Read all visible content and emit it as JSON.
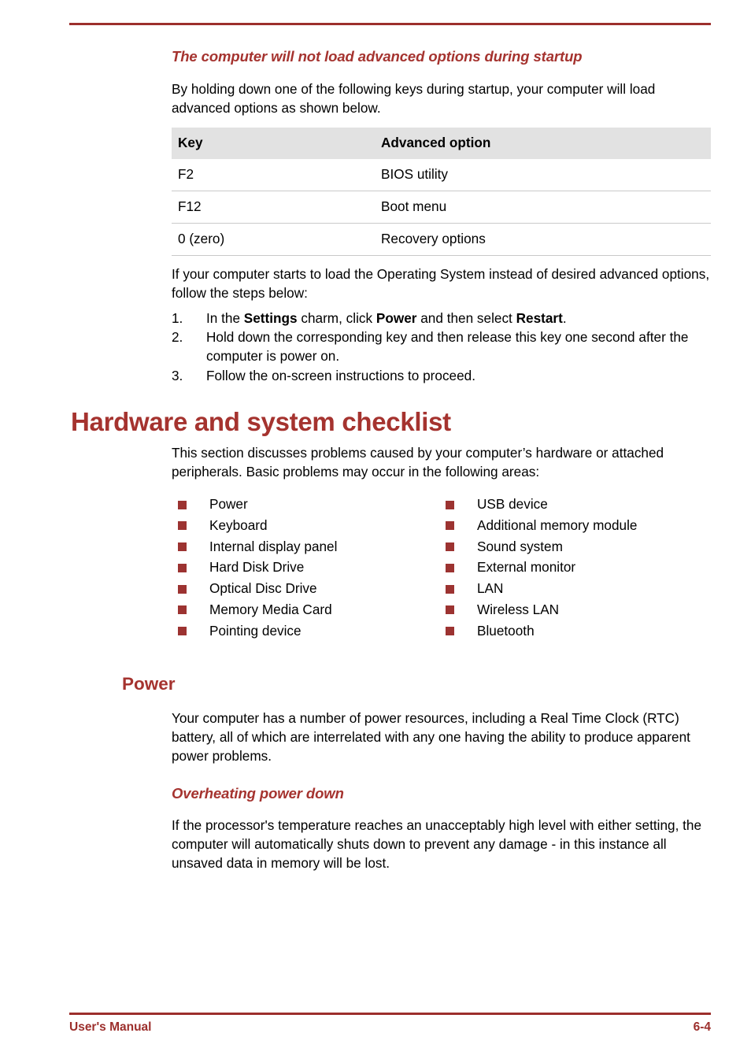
{
  "page": {
    "rule_color": "#9c2f2c",
    "heading_color": "#a5332f",
    "bullet_color": "#9c3331",
    "table_header_bg": "#e2e2e2"
  },
  "section_heading_1": "The computer will not load advanced options during startup",
  "intro_paragraph": "By holding down one of the following keys during startup, your computer will load advanced options as shown below.",
  "table": {
    "headers": [
      "Key",
      "Advanced option"
    ],
    "rows": [
      {
        "key": "F2",
        "option": "BIOS utility"
      },
      {
        "key": "F12",
        "option": "Boot menu"
      },
      {
        "key": "0 (zero)",
        "option": "Recovery options"
      }
    ]
  },
  "after_table_paragraph": "If your computer starts to load the Operating System instead of desired advanced options, follow the steps below:",
  "steps": [
    {
      "num": "1.",
      "html": "In the <b>Settings</b> charm, click <b>Power</b> and then select <b>Restart</b>."
    },
    {
      "num": "2.",
      "html": "Hold down the corresponding key and then release this key one second after the computer is power on."
    },
    {
      "num": "3.",
      "html": "Follow the on-screen instructions to proceed."
    }
  ],
  "chapter_heading": "Hardware and system checklist",
  "chapter_paragraph": "This section discusses problems caused by your computer’s hardware or attached peripherals. Basic problems may occur in the following areas:",
  "checklist": {
    "left_column": [
      "Power",
      "Keyboard",
      "Internal display panel",
      "Hard Disk Drive",
      "Optical Disc Drive",
      "Memory Media Card",
      "Pointing device"
    ],
    "right_column": [
      "USB device",
      "Additional memory module",
      "Sound system",
      "External monitor",
      "LAN",
      "Wireless LAN",
      "Bluetooth"
    ]
  },
  "power_heading": "Power",
  "power_paragraph": "Your computer has a number of power resources, including a Real Time Clock (RTC) battery, all of which are interrelated with any one having the ability to produce apparent power problems.",
  "overheating_heading": "Overheating power down",
  "overheating_paragraph": "If the processor's temperature reaches an unacceptably high level with either setting, the computer will automatically shuts down to prevent any damage - in this instance all unsaved data in memory will be lost.",
  "footer": {
    "left": "User's Manual",
    "right": "6-4"
  }
}
